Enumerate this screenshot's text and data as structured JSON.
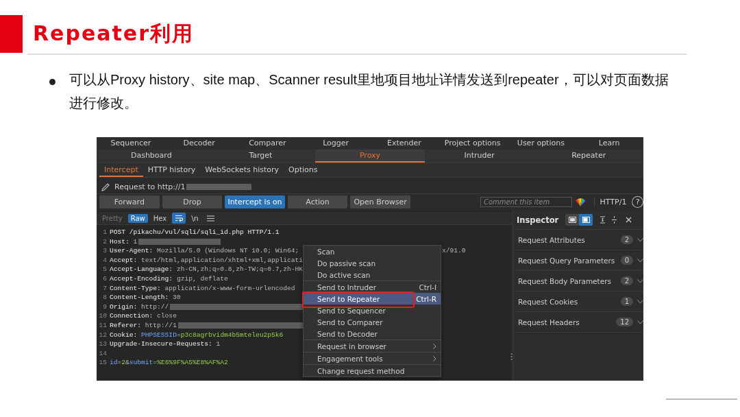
{
  "slide": {
    "title": "Repeater利用",
    "bullet": "可以从Proxy history、site map、Scanner result里地项目地址详情发送到repeater，可以对页面数据进行修改。"
  },
  "app": {
    "tool_tabs": [
      {
        "label": "Sequencer",
        "selected": false
      },
      {
        "label": "Decoder",
        "selected": false
      },
      {
        "label": "Comparer",
        "selected": false
      },
      {
        "label": "Logger",
        "selected": false
      },
      {
        "label": "Extender",
        "selected": false
      },
      {
        "label": "Project options",
        "selected": false
      },
      {
        "label": "User options",
        "selected": false
      },
      {
        "label": "Learn",
        "selected": false
      }
    ],
    "main_tabs": [
      {
        "label": "Dashboard",
        "selected": false
      },
      {
        "label": "Target",
        "selected": false
      },
      {
        "label": "Proxy",
        "selected": true
      },
      {
        "label": "Intruder",
        "selected": false
      },
      {
        "label": "Repeater",
        "selected": false
      }
    ],
    "proxy_tabs": [
      {
        "label": "Intercept",
        "selected": true
      },
      {
        "label": "HTTP history",
        "selected": false
      },
      {
        "label": "WebSockets history",
        "selected": false
      },
      {
        "label": "Options",
        "selected": false
      }
    ],
    "request_label": "Request to http://1",
    "buttons": [
      {
        "label": "Forward",
        "on": false
      },
      {
        "label": "Drop",
        "on": false
      },
      {
        "label": "Intercept is on",
        "on": true
      },
      {
        "label": "Action",
        "on": false
      },
      {
        "label": "Open Browser",
        "on": false
      }
    ],
    "comment": {
      "placeholder": "Comment this item"
    },
    "protocol": "HTTP/1",
    "help": "?",
    "view_tabs": [
      {
        "label": "Pretty",
        "selected": false,
        "disabled": true
      },
      {
        "label": "Raw",
        "selected": true,
        "disabled": false
      },
      {
        "label": "Hex",
        "selected": false,
        "disabled": false
      }
    ],
    "wrap": {
      "on": true
    },
    "newline_toggle": "\\n",
    "lines": [
      {
        "number": "1",
        "segments": [
          {
            "kind": "key",
            "text": "POST /pikachu/vul/sqli/sqli_id.php HTTP/1.1"
          }
        ]
      },
      {
        "number": "2",
        "segments": [
          {
            "kind": "key",
            "text": "Host:"
          },
          {
            "kind": "value",
            "text": " 1"
          },
          {
            "kind": "redacted"
          }
        ]
      },
      {
        "number": "3",
        "segments": [
          {
            "kind": "key",
            "text": "User-Agent:"
          },
          {
            "kind": "value",
            "text": " Mozilla/5.0 (Windows NT 10.0; Win64;"
          }
        ],
        "tail": "x/91.0"
      },
      {
        "number": "4",
        "segments": [
          {
            "kind": "key",
            "text": "Accept:"
          },
          {
            "kind": "value",
            "text": " text/html,application/xhtml+xml,applicati"
          }
        ]
      },
      {
        "number": "5",
        "segments": [
          {
            "kind": "key",
            "text": "Accept-Language:"
          },
          {
            "kind": "value",
            "text": " zh-CN,zh;q=0.8,zh-TW;q=0.7,zh-HK"
          }
        ]
      },
      {
        "number": "6",
        "segments": [
          {
            "kind": "key",
            "text": "Accept-Encoding:"
          },
          {
            "kind": "value",
            "text": " gzip, deflate"
          }
        ]
      },
      {
        "number": "7",
        "segments": [
          {
            "kind": "key",
            "text": "Content-Type:"
          },
          {
            "kind": "value",
            "text": " application/x-www-form-urlencoded"
          }
        ]
      },
      {
        "number": "8",
        "segments": [
          {
            "kind": "key",
            "text": "Content-Length:"
          },
          {
            "kind": "value",
            "text": " 30"
          }
        ]
      },
      {
        "number": "9",
        "segments": [
          {
            "kind": "key",
            "text": "Origin:"
          },
          {
            "kind": "value",
            "text": " http://"
          },
          {
            "kind": "redacted-long"
          }
        ]
      },
      {
        "number": "10",
        "segments": [
          {
            "kind": "key",
            "text": "Connection:"
          },
          {
            "kind": "value",
            "text": " close"
          }
        ]
      },
      {
        "number": "11",
        "segments": [
          {
            "kind": "key",
            "text": "Referer:"
          },
          {
            "kind": "value",
            "text": " http://1"
          },
          {
            "kind": "redacted-long"
          }
        ]
      },
      {
        "number": "12",
        "segments": [
          {
            "kind": "key",
            "text": "Cookie:"
          },
          {
            "kind": "param",
            "text": " PHPSESSID"
          },
          {
            "kind": "value",
            "text": "="
          },
          {
            "kind": "param-value",
            "text": "p3c8agrbvidm4b5mteleu2p5k6"
          }
        ]
      },
      {
        "number": "13",
        "segments": [
          {
            "kind": "key",
            "text": "Upgrade-Insecure-Requests:"
          },
          {
            "kind": "value",
            "text": " 1"
          }
        ]
      },
      {
        "number": "14"
      },
      {
        "number": "15",
        "segments": [
          {
            "kind": "param",
            "text": "id"
          },
          {
            "kind": "value",
            "text": "="
          },
          {
            "kind": "param-value",
            "text": "2"
          },
          {
            "kind": "value",
            "text": "&"
          },
          {
            "kind": "param",
            "text": "submit"
          },
          {
            "kind": "value",
            "text": "="
          },
          {
            "kind": "param-value",
            "text": "%E6%9F%A5%E8%AF%A2"
          }
        ]
      }
    ],
    "inspector": {
      "title": "Inspector",
      "layouts": [
        {
          "selected": false
        },
        {
          "selected": true
        }
      ],
      "sections": [
        {
          "label": "Request Attributes",
          "count": "2"
        },
        {
          "label": "Request Query Parameters",
          "count": "0"
        },
        {
          "label": "Request Body Parameters",
          "count": "2"
        },
        {
          "label": "Request Cookies",
          "count": "1"
        },
        {
          "label": "Request Headers",
          "count": "12"
        }
      ]
    },
    "context_menu": {
      "groups": [
        [
          {
            "label": "Scan",
            "selected": false,
            "highlighted": false
          },
          {
            "label": "Do passive scan",
            "selected": false,
            "highlighted": false
          },
          {
            "label": "Do active scan",
            "selected": false,
            "highlighted": false
          }
        ],
        [
          {
            "label": "Send to Intruder",
            "shortcut": "Ctrl-I",
            "selected": false,
            "highlighted": false
          },
          {
            "label": "Send to Repeater",
            "shortcut": "Ctrl-R",
            "selected": true,
            "highlighted": true
          },
          {
            "label": "Send to Sequencer",
            "selected": false,
            "highlighted": false
          },
          {
            "label": "Send to Comparer",
            "selected": false,
            "highlighted": false
          },
          {
            "label": "Send to Decoder",
            "selected": false,
            "highlighted": false
          }
        ],
        [
          {
            "label": "Request in browser",
            "submenu": true,
            "selected": false,
            "highlighted": false
          }
        ],
        [
          {
            "label": "Engagement tools",
            "submenu": true,
            "selected": false,
            "highlighted": false
          }
        ],
        [
          {
            "label": "Change request method",
            "selected": false,
            "highlighted": false
          }
        ]
      ]
    }
  }
}
